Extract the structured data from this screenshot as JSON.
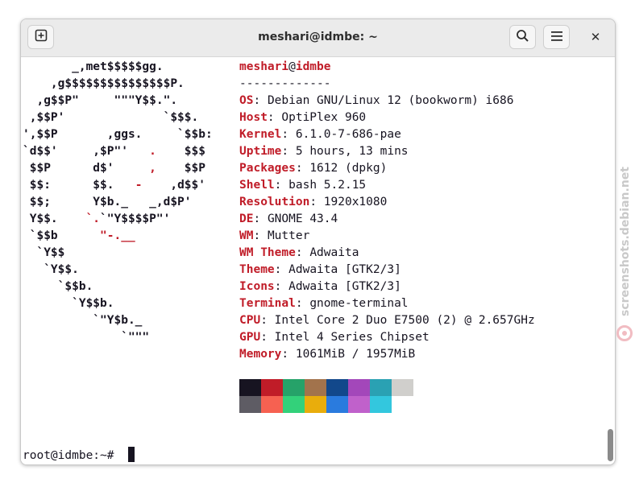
{
  "window": {
    "title": "meshari@idmbe: ~",
    "new_tab_icon": "new-tab-icon",
    "search_icon": "search-icon",
    "menu_icon": "hamburger-menu-icon",
    "close_label": "✕"
  },
  "neofetch": {
    "logo_lines": [
      [
        {
          "t": "       _,met$$$$$gg.",
          "red": false
        }
      ],
      [
        {
          "t": "    ,g$$$$$$$$$$$$$$$P.",
          "red": false
        }
      ],
      [
        {
          "t": "  ,g$$P\"     \"\"\"Y$$.\".",
          "red": false
        }
      ],
      [
        {
          "t": " ,$$P'              `$$$.",
          "red": false
        }
      ],
      [
        {
          "t": "',$$P       ,ggs.     `$$b:",
          "red": false
        }
      ],
      [
        {
          "t": "`d$$'     ,$P\"'   ",
          "red": false
        },
        {
          "t": ".",
          "red": true
        },
        {
          "t": "    $$$",
          "red": false
        }
      ],
      [
        {
          "t": " $$P      d$'     ",
          "red": false
        },
        {
          "t": ",",
          "red": true
        },
        {
          "t": "    $$P",
          "red": false
        }
      ],
      [
        {
          "t": " $$:      $$.   ",
          "red": false
        },
        {
          "t": "-",
          "red": true
        },
        {
          "t": "    ,d$$'",
          "red": false
        }
      ],
      [
        {
          "t": " $$;      Y$b._   _,d$P'",
          "red": false
        }
      ],
      [
        {
          "t": " Y$$.    ",
          "red": false
        },
        {
          "t": "`.",
          "red": true
        },
        {
          "t": "`\"Y$$$$P\"'",
          "red": false
        }
      ],
      [
        {
          "t": " `$$b      ",
          "red": false
        },
        {
          "t": "\"-.__",
          "red": true
        }
      ],
      [
        {
          "t": "  `Y$$",
          "red": false
        }
      ],
      [
        {
          "t": "   `Y$$.",
          "red": false
        }
      ],
      [
        {
          "t": "     `$$b.",
          "red": false
        }
      ],
      [
        {
          "t": "       `Y$$b.",
          "red": false
        }
      ],
      [
        {
          "t": "          `\"Y$b._",
          "red": false
        }
      ],
      [
        {
          "t": "              `\"\"\"",
          "red": false
        }
      ]
    ],
    "user": "meshari",
    "at": "@",
    "host": "idmbe",
    "separator": "-------------",
    "info": [
      {
        "key": "OS",
        "value": "Debian GNU/Linux 12 (bookworm) i686"
      },
      {
        "key": "Host",
        "value": "OptiPlex 960"
      },
      {
        "key": "Kernel",
        "value": "6.1.0-7-686-pae"
      },
      {
        "key": "Uptime",
        "value": "5 hours, 13 mins"
      },
      {
        "key": "Packages",
        "value": "1612 (dpkg)"
      },
      {
        "key": "Shell",
        "value": "bash 5.2.15"
      },
      {
        "key": "Resolution",
        "value": "1920x1080"
      },
      {
        "key": "DE",
        "value": "GNOME 43.4"
      },
      {
        "key": "WM",
        "value": "Mutter"
      },
      {
        "key": "WM Theme",
        "value": "Adwaita"
      },
      {
        "key": "Theme",
        "value": "Adwaita [GTK2/3]"
      },
      {
        "key": "Icons",
        "value": "Adwaita [GTK2/3]"
      },
      {
        "key": "Terminal",
        "value": "gnome-terminal"
      },
      {
        "key": "CPU",
        "value": "Intel Core 2 Duo E7500 (2) @ 2.657GHz"
      },
      {
        "key": "GPU",
        "value": "Intel 4 Series Chipset"
      },
      {
        "key": "Memory",
        "value": "1061MiB / 1957MiB"
      }
    ],
    "palette_dark": [
      "#171421",
      "#c01c28",
      "#26a269",
      "#a2734c",
      "#12488b",
      "#a347ba",
      "#2aa1b3",
      "#d0cfcc"
    ],
    "palette_bright": [
      "#5e5c64",
      "#f66151",
      "#33d17a",
      "#e9ad0c",
      "#2a7bde",
      "#c061cb",
      "#33c7de",
      "#ffffff"
    ]
  },
  "prompt": "root@idmbe:~# ",
  "watermark": {
    "text": "screenshots.debian.net"
  },
  "colors": {
    "accent_red": "#c01c28",
    "foreground": "#171421",
    "background": "#ffffff"
  }
}
